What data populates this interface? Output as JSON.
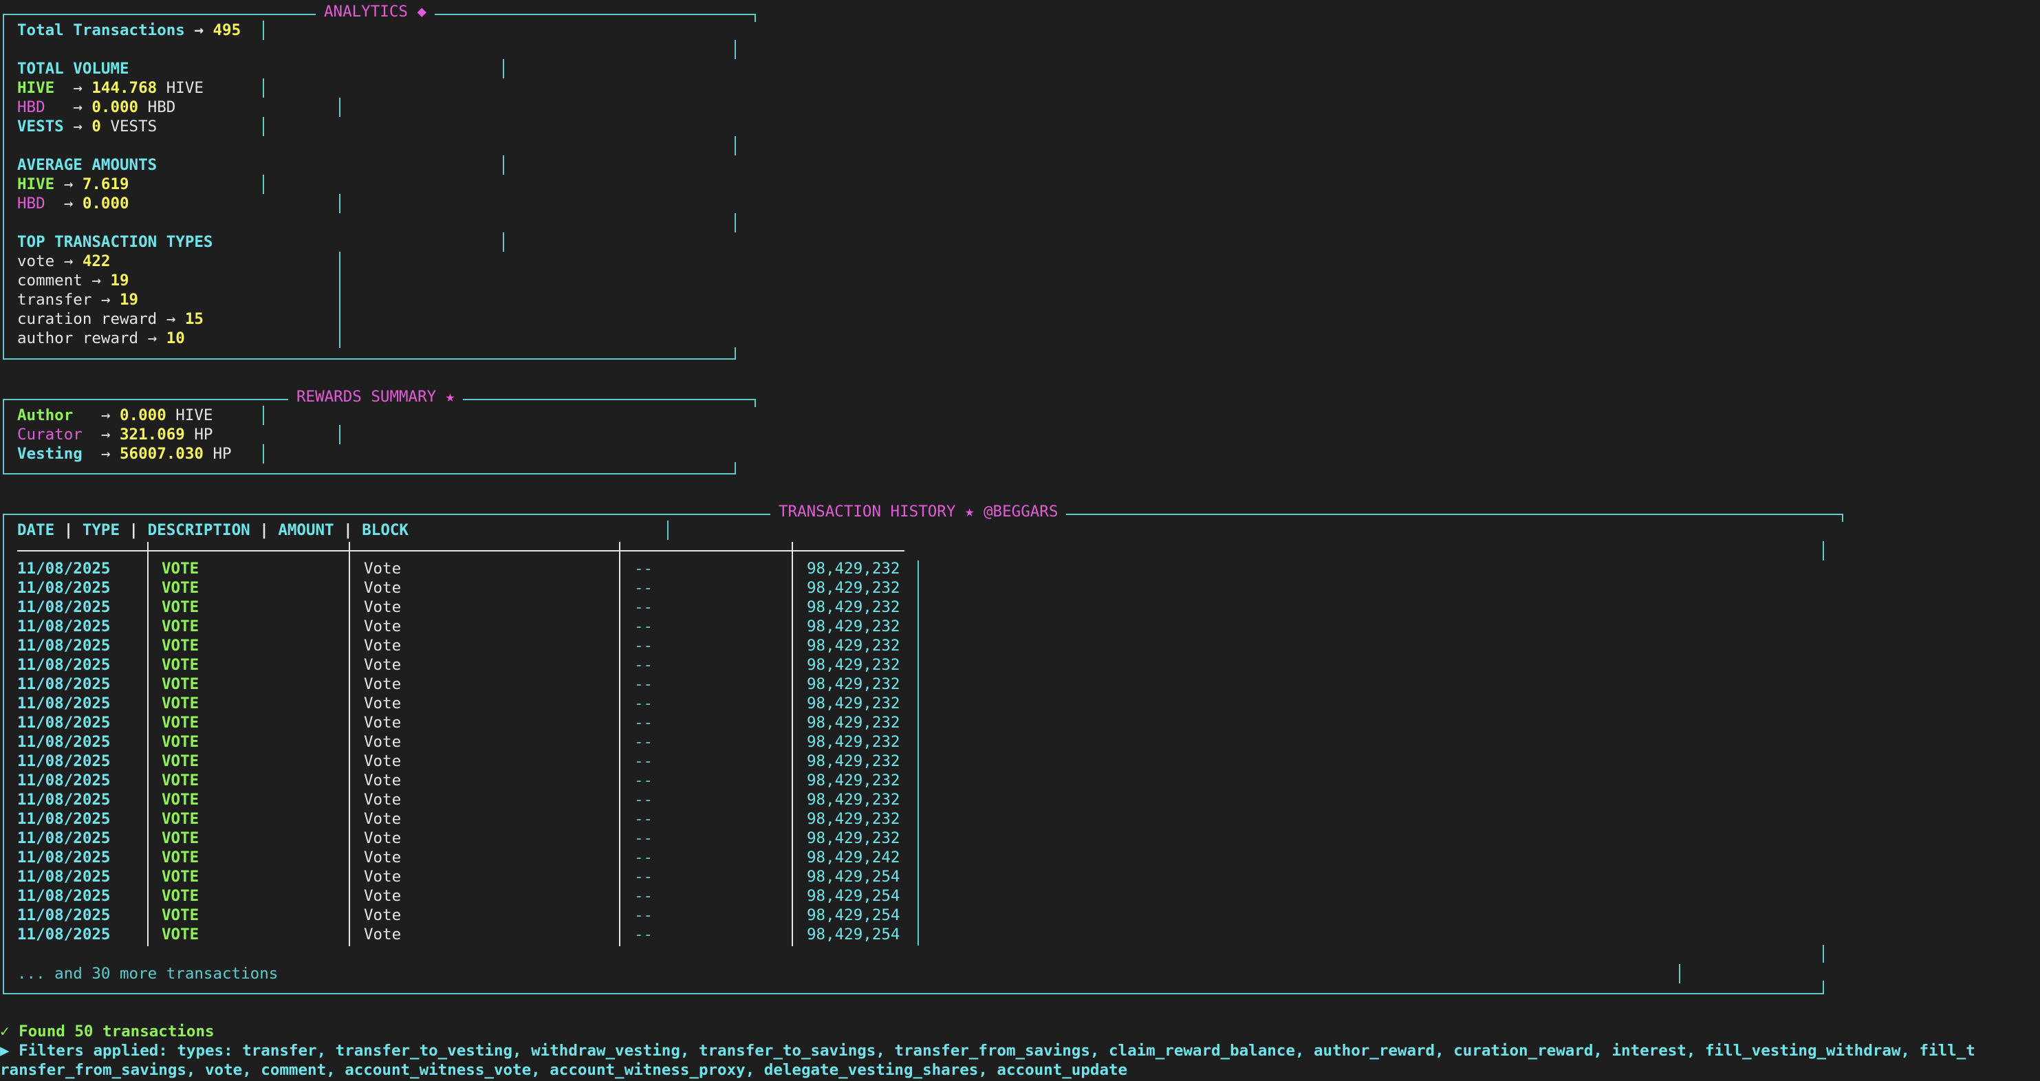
{
  "analytics": {
    "title": "ANALYTICS ◆",
    "total_label": "Total Transactions",
    "total_value": "495",
    "volume_header": "TOTAL VOLUME",
    "volume": [
      {
        "currency": "HIVE",
        "value": "144.768",
        "unit": "HIVE"
      },
      {
        "currency": "HBD",
        "value": "0.000",
        "unit": "HBD"
      },
      {
        "currency": "VESTS",
        "value": "0",
        "unit": "VESTS"
      }
    ],
    "average_header": "AVERAGE AMOUNTS",
    "average": [
      {
        "currency": "HIVE",
        "value": "7.619"
      },
      {
        "currency": "HBD",
        "value": "0.000"
      }
    ],
    "types_header": "TOP TRANSACTION TYPES",
    "types": [
      {
        "name": "vote",
        "count": "422"
      },
      {
        "name": "comment",
        "count": "19"
      },
      {
        "name": "transfer",
        "count": "19"
      },
      {
        "name": "curation reward",
        "count": "15"
      },
      {
        "name": "author reward",
        "count": "10"
      }
    ]
  },
  "rewards": {
    "title": "REWARDS SUMMARY ★",
    "items": [
      {
        "label": "Author",
        "value": "0.000",
        "unit": "HIVE"
      },
      {
        "label": "Curator",
        "value": "321.069",
        "unit": "HP"
      },
      {
        "label": "Vesting",
        "value": "56007.030",
        "unit": "HP"
      }
    ]
  },
  "history": {
    "title": "TRANSACTION HISTORY ★ @BEGGARS",
    "columns": [
      "DATE",
      "TYPE",
      "DESCRIPTION",
      "AMOUNT",
      "BLOCK"
    ],
    "rows": [
      {
        "date": "11/08/2025",
        "type": "VOTE",
        "description": "Vote",
        "amount": "--",
        "block": "98,429,232"
      },
      {
        "date": "11/08/2025",
        "type": "VOTE",
        "description": "Vote",
        "amount": "--",
        "block": "98,429,232"
      },
      {
        "date": "11/08/2025",
        "type": "VOTE",
        "description": "Vote",
        "amount": "--",
        "block": "98,429,232"
      },
      {
        "date": "11/08/2025",
        "type": "VOTE",
        "description": "Vote",
        "amount": "--",
        "block": "98,429,232"
      },
      {
        "date": "11/08/2025",
        "type": "VOTE",
        "description": "Vote",
        "amount": "--",
        "block": "98,429,232"
      },
      {
        "date": "11/08/2025",
        "type": "VOTE",
        "description": "Vote",
        "amount": "--",
        "block": "98,429,232"
      },
      {
        "date": "11/08/2025",
        "type": "VOTE",
        "description": "Vote",
        "amount": "--",
        "block": "98,429,232"
      },
      {
        "date": "11/08/2025",
        "type": "VOTE",
        "description": "Vote",
        "amount": "--",
        "block": "98,429,232"
      },
      {
        "date": "11/08/2025",
        "type": "VOTE",
        "description": "Vote",
        "amount": "--",
        "block": "98,429,232"
      },
      {
        "date": "11/08/2025",
        "type": "VOTE",
        "description": "Vote",
        "amount": "--",
        "block": "98,429,232"
      },
      {
        "date": "11/08/2025",
        "type": "VOTE",
        "description": "Vote",
        "amount": "--",
        "block": "98,429,232"
      },
      {
        "date": "11/08/2025",
        "type": "VOTE",
        "description": "Vote",
        "amount": "--",
        "block": "98,429,232"
      },
      {
        "date": "11/08/2025",
        "type": "VOTE",
        "description": "Vote",
        "amount": "--",
        "block": "98,429,232"
      },
      {
        "date": "11/08/2025",
        "type": "VOTE",
        "description": "Vote",
        "amount": "--",
        "block": "98,429,232"
      },
      {
        "date": "11/08/2025",
        "type": "VOTE",
        "description": "Vote",
        "amount": "--",
        "block": "98,429,232"
      },
      {
        "date": "11/08/2025",
        "type": "VOTE",
        "description": "Vote",
        "amount": "--",
        "block": "98,429,242"
      },
      {
        "date": "11/08/2025",
        "type": "VOTE",
        "description": "Vote",
        "amount": "--",
        "block": "98,429,254"
      },
      {
        "date": "11/08/2025",
        "type": "VOTE",
        "description": "Vote",
        "amount": "--",
        "block": "98,429,254"
      },
      {
        "date": "11/08/2025",
        "type": "VOTE",
        "description": "Vote",
        "amount": "--",
        "block": "98,429,254"
      },
      {
        "date": "11/08/2025",
        "type": "VOTE",
        "description": "Vote",
        "amount": "--",
        "block": "98,429,254"
      }
    ],
    "more": "... and 30 more transactions"
  },
  "status": {
    "found": "✓ Found 50 transactions",
    "filters_line1": "▶ Filters applied: types: transfer, transfer_to_vesting, withdraw_vesting, transfer_to_savings, transfer_from_savings, claim_reward_balance, author_reward, curation_reward, interest, fill_vesting_withdraw, fill_t",
    "filters_line2": "ransfer_from_savings, vote, comment, account_witness_vote, account_witness_proxy, delegate_vesting_shares, account_update"
  }
}
